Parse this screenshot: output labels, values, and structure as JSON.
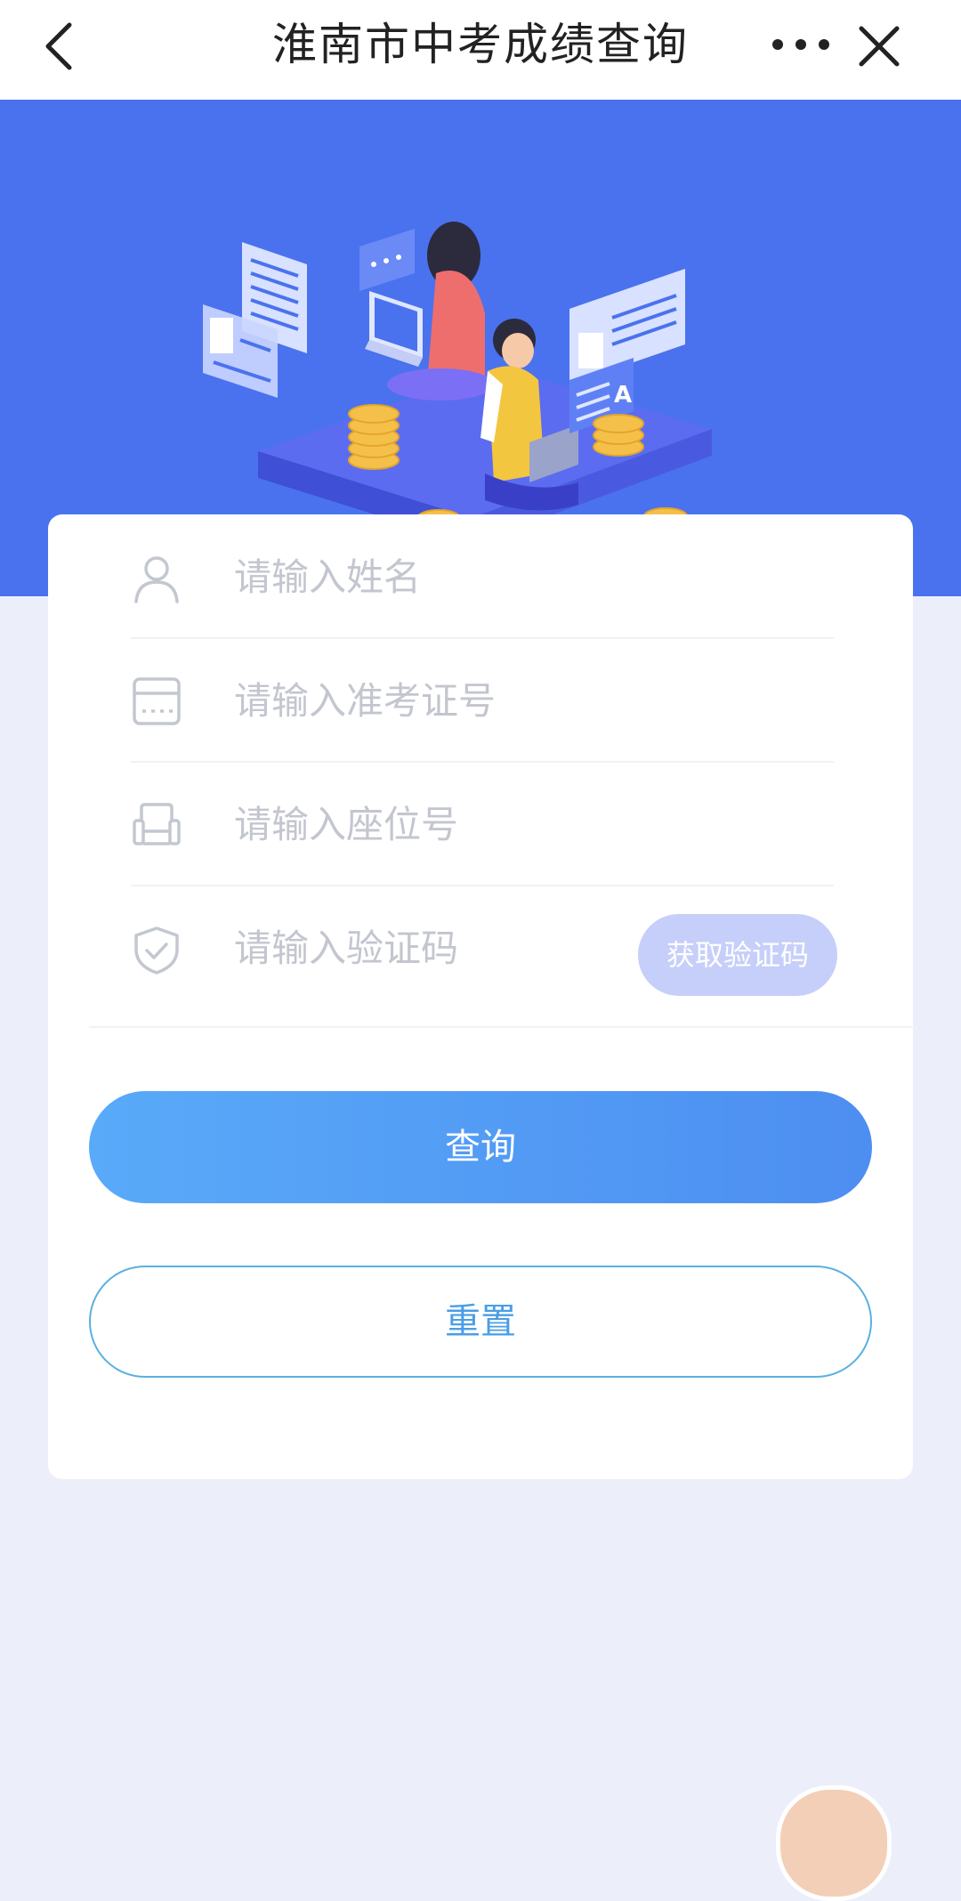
{
  "navbar": {
    "title": "淮南市中考成绩查询",
    "back_icon": "chevron-left-icon",
    "more_icon": "more-dots-icon",
    "close_icon": "close-icon"
  },
  "banner": {
    "background_color": "#4a72ee",
    "illustration": "students-studying-with-laptops"
  },
  "form": {
    "fields": [
      {
        "icon": "user-icon",
        "placeholder": "请输入姓名",
        "value": ""
      },
      {
        "icon": "id-card-icon",
        "placeholder": "请输入准考证号",
        "value": ""
      },
      {
        "icon": "seat-icon",
        "placeholder": "请输入座位号",
        "value": ""
      },
      {
        "icon": "shield-check-icon",
        "placeholder": "请输入验证码",
        "value": ""
      }
    ],
    "get_code_label": "获取验证码",
    "query_label": "查询",
    "reset_label": "重置"
  },
  "colors": {
    "accent": "#4d8ef1",
    "page_background": "#eceffa",
    "code_button": "#c6cffa",
    "reset_border": "#5ab0e0"
  }
}
